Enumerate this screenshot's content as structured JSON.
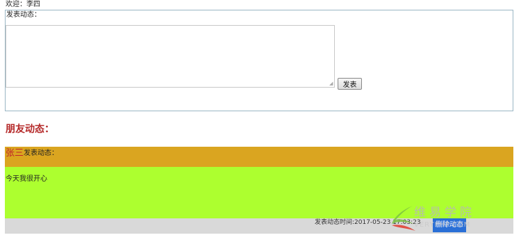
{
  "header": {
    "welcome": "欢迎：李四"
  },
  "compose": {
    "label": "发表动态：",
    "textarea_value": "",
    "publish_label": "发表"
  },
  "feed": {
    "heading": "朋友动态：",
    "posts": [
      {
        "author": "张三",
        "action": "发表动态：",
        "content": "今天我很开心",
        "time": "发表动态时间:2017-05-23 17:03:23",
        "delete_label": "删除动态"
      }
    ]
  },
  "watermark": {
    "logo_cn": "维易学院",
    "logo_en": "VERYPHP.COM"
  },
  "colors": {
    "compose_border": "#9ab6c4",
    "heading": "#b52a2a",
    "post_header_bg": "#daa520",
    "author": "#c0252a",
    "post_body_bg": "#adff2f",
    "post_footer_bg": "#d9d9d9"
  }
}
